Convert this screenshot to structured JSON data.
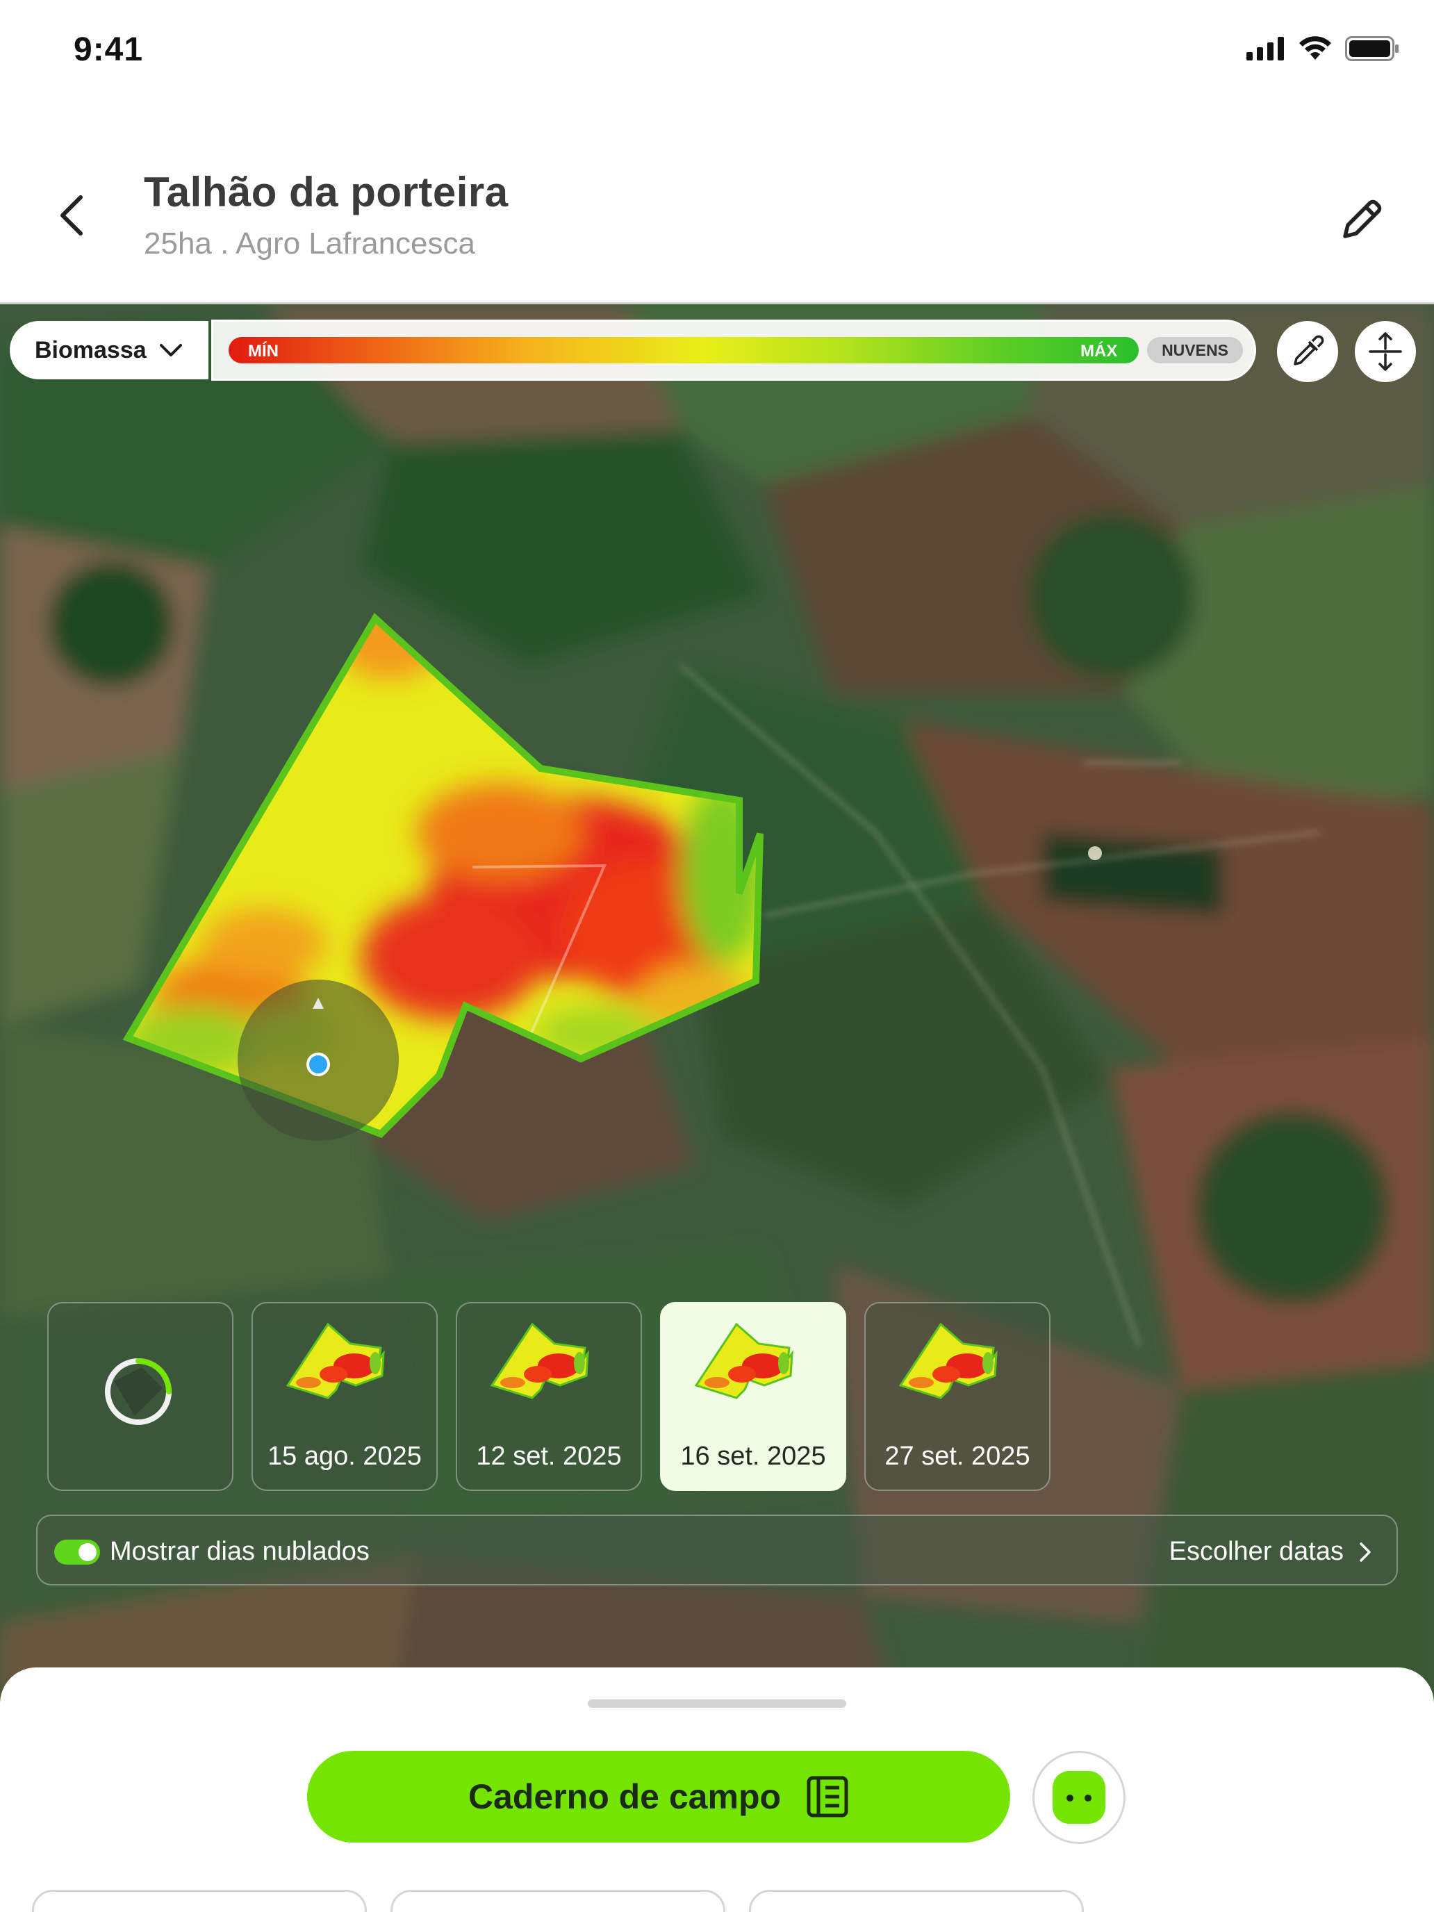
{
  "status_bar": {
    "time": "9:41"
  },
  "header": {
    "title": "Talhão da porteira",
    "subtitle": "25ha . Agro Lafrancesca"
  },
  "map_controls": {
    "layer": "Biomassa",
    "legend": {
      "min_label": "MÍN",
      "max_label": "MÁX",
      "clouds_label": "NUVENS"
    }
  },
  "dates": [
    {
      "label": "15 ago. 2025",
      "selected": false
    },
    {
      "label": "12 set. 2025",
      "selected": false
    },
    {
      "label": "16 set. 2025",
      "selected": true
    },
    {
      "label": "27 set. 2025",
      "selected": false
    }
  ],
  "cloudy_days": {
    "label": "Mostrar dias nublados",
    "enabled": true,
    "choose_label": "Escolher datas"
  },
  "bottom_sheet": {
    "primary_button": "Caderno de campo"
  },
  "colors": {
    "accent": "#74e500",
    "field_outline": "#5bc41c"
  }
}
